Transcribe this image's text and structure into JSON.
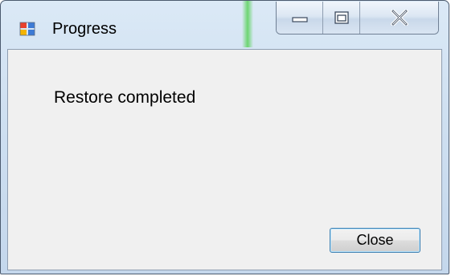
{
  "window": {
    "title": "Progress",
    "icon": "application-icon"
  },
  "caption_buttons": {
    "minimize_icon": "minimize-icon",
    "maximize_icon": "maximize-icon",
    "close_icon": "close-icon"
  },
  "content": {
    "message": "Restore completed"
  },
  "actions": {
    "close_label": "Close"
  },
  "colors": {
    "client_background": "#f0f0f0",
    "button_focus_border": "#3c7fb1",
    "title_glass": "#cfe0f1"
  }
}
